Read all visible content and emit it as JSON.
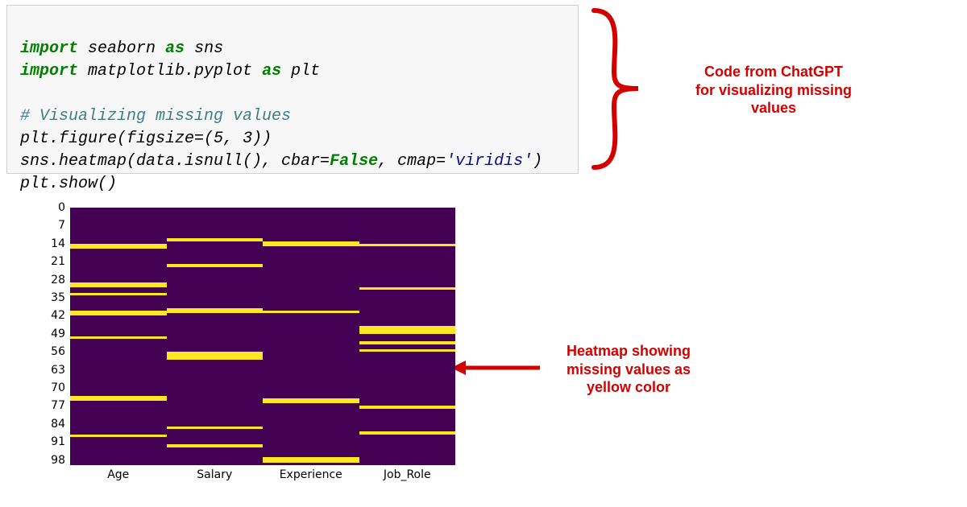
{
  "code": {
    "tokens": {
      "import1": "import",
      "seaborn": " seaborn ",
      "as1": "as",
      "sns": " sns",
      "import2": "import",
      "mpl": " matplotlib.pyplot ",
      "as2": "as",
      "plt": " plt",
      "comment": "# Visualizing missing values",
      "l3": "plt.figure(figsize=(",
      "l3b": "5",
      "l3c": ", ",
      "l3d": "3",
      "l3e": "))",
      "l4a": "sns.heatmap(data.isnull(), cbar=",
      "l4b": "False",
      "l4c": ", cmap=",
      "l4d": "'viridis'",
      "l4e": ")",
      "l5": "plt.show()"
    }
  },
  "annotations": {
    "top": "Code from ChatGPT\nfor visualizing missing\nvalues",
    "bottom": "Heatmap showing\nmissing values as\nyellow color"
  },
  "chart_data": {
    "type": "heatmap",
    "title": "",
    "xlabel": "",
    "ylabel": "",
    "x_categories": [
      "Age",
      "Salary",
      "Experience",
      "Job_Role"
    ],
    "y_ticks": [
      0,
      7,
      14,
      21,
      28,
      35,
      42,
      49,
      56,
      63,
      70,
      77,
      84,
      91,
      98
    ],
    "ylim": [
      0,
      100
    ],
    "colormap": "viridis",
    "missing_color": "#fde725",
    "present_color": "#440154",
    "columns": {
      "Age": [
        14,
        15,
        29,
        30,
        33,
        40,
        41,
        50,
        73,
        74,
        88
      ],
      "Salary": [
        12,
        22,
        39,
        40,
        56,
        57,
        58,
        85,
        92
      ],
      "Experience": [
        13,
        14,
        40,
        74,
        75,
        97,
        98
      ],
      "Job_Role": [
        14,
        31,
        46,
        47,
        48,
        52,
        55,
        77,
        87
      ]
    }
  }
}
